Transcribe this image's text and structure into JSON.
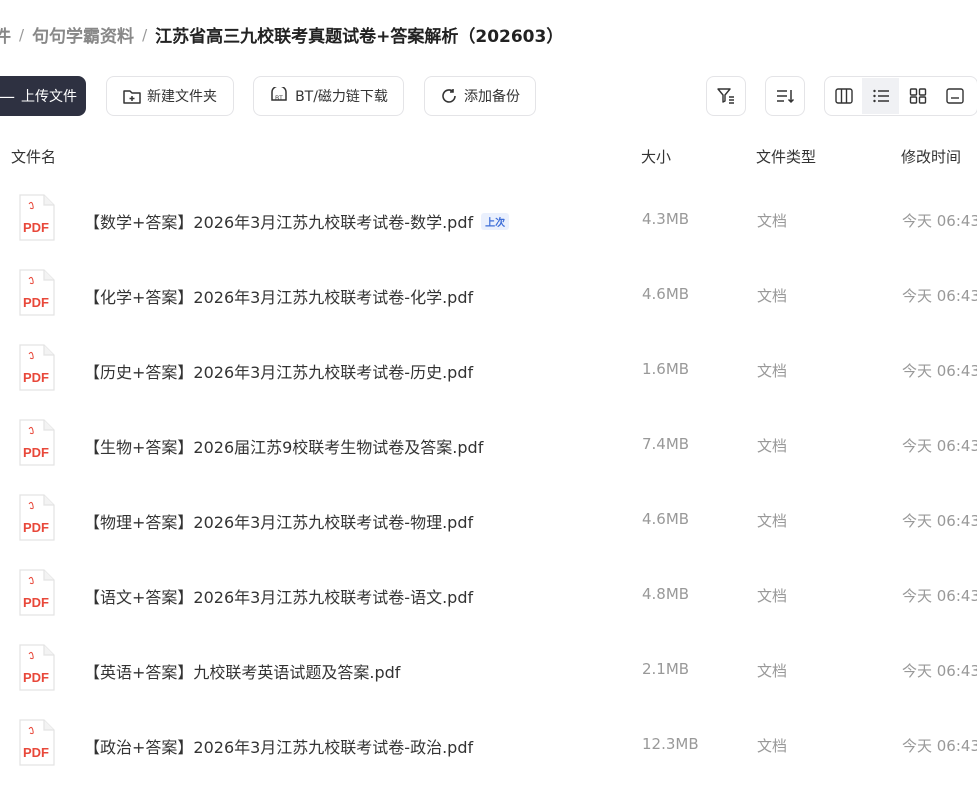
{
  "breadcrumb": {
    "items": [
      "件",
      "句句学霸资料",
      "江苏省高三九校联考真题试卷+答案解析（202603）"
    ],
    "separator": "/"
  },
  "toolbar": {
    "upload_label": "上传文件",
    "new_folder_label": "新建文件夹",
    "bt_download_label": "BT/磁力链下载",
    "add_backup_label": "添加备份"
  },
  "table": {
    "columns": {
      "name": "文件名",
      "size": "大小",
      "type": "文件类型",
      "modified": "修改时间"
    },
    "rows": [
      {
        "name": "【数学+答案】2026年3月江苏九校联考试卷-数学.pdf",
        "tag": "上次",
        "size": "4.3MB",
        "type": "文档",
        "modified": "今天 06:43"
      },
      {
        "name": "【化学+答案】2026年3月江苏九校联考试卷-化学.pdf",
        "size": "4.6MB",
        "type": "文档",
        "modified": "今天 06:43"
      },
      {
        "name": "【历史+答案】2026年3月江苏九校联考试卷-历史.pdf",
        "size": "1.6MB",
        "type": "文档",
        "modified": "今天 06:43"
      },
      {
        "name": "【生物+答案】2026届江苏9校联考生物试卷及答案.pdf",
        "size": "7.4MB",
        "type": "文档",
        "modified": "今天 06:43"
      },
      {
        "name": "【物理+答案】2026年3月江苏九校联考试卷-物理.pdf",
        "size": "4.6MB",
        "type": "文档",
        "modified": "今天 06:43"
      },
      {
        "name": "【语文+答案】2026年3月江苏九校联考试卷-语文.pdf",
        "size": "4.8MB",
        "type": "文档",
        "modified": "今天 06:43"
      },
      {
        "name": "【英语+答案】九校联考英语试题及答案.pdf",
        "size": "2.1MB",
        "type": "文档",
        "modified": "今天 06:43"
      },
      {
        "name": "【政治+答案】2026年3月江苏九校联考试卷-政治.pdf",
        "size": "12.3MB",
        "type": "文档",
        "modified": "今天 06:43"
      }
    ]
  },
  "icons": {
    "file_icon": "pdf-file-icon",
    "file_icon_label": "PDF",
    "pdf_color": "#e8483a"
  }
}
